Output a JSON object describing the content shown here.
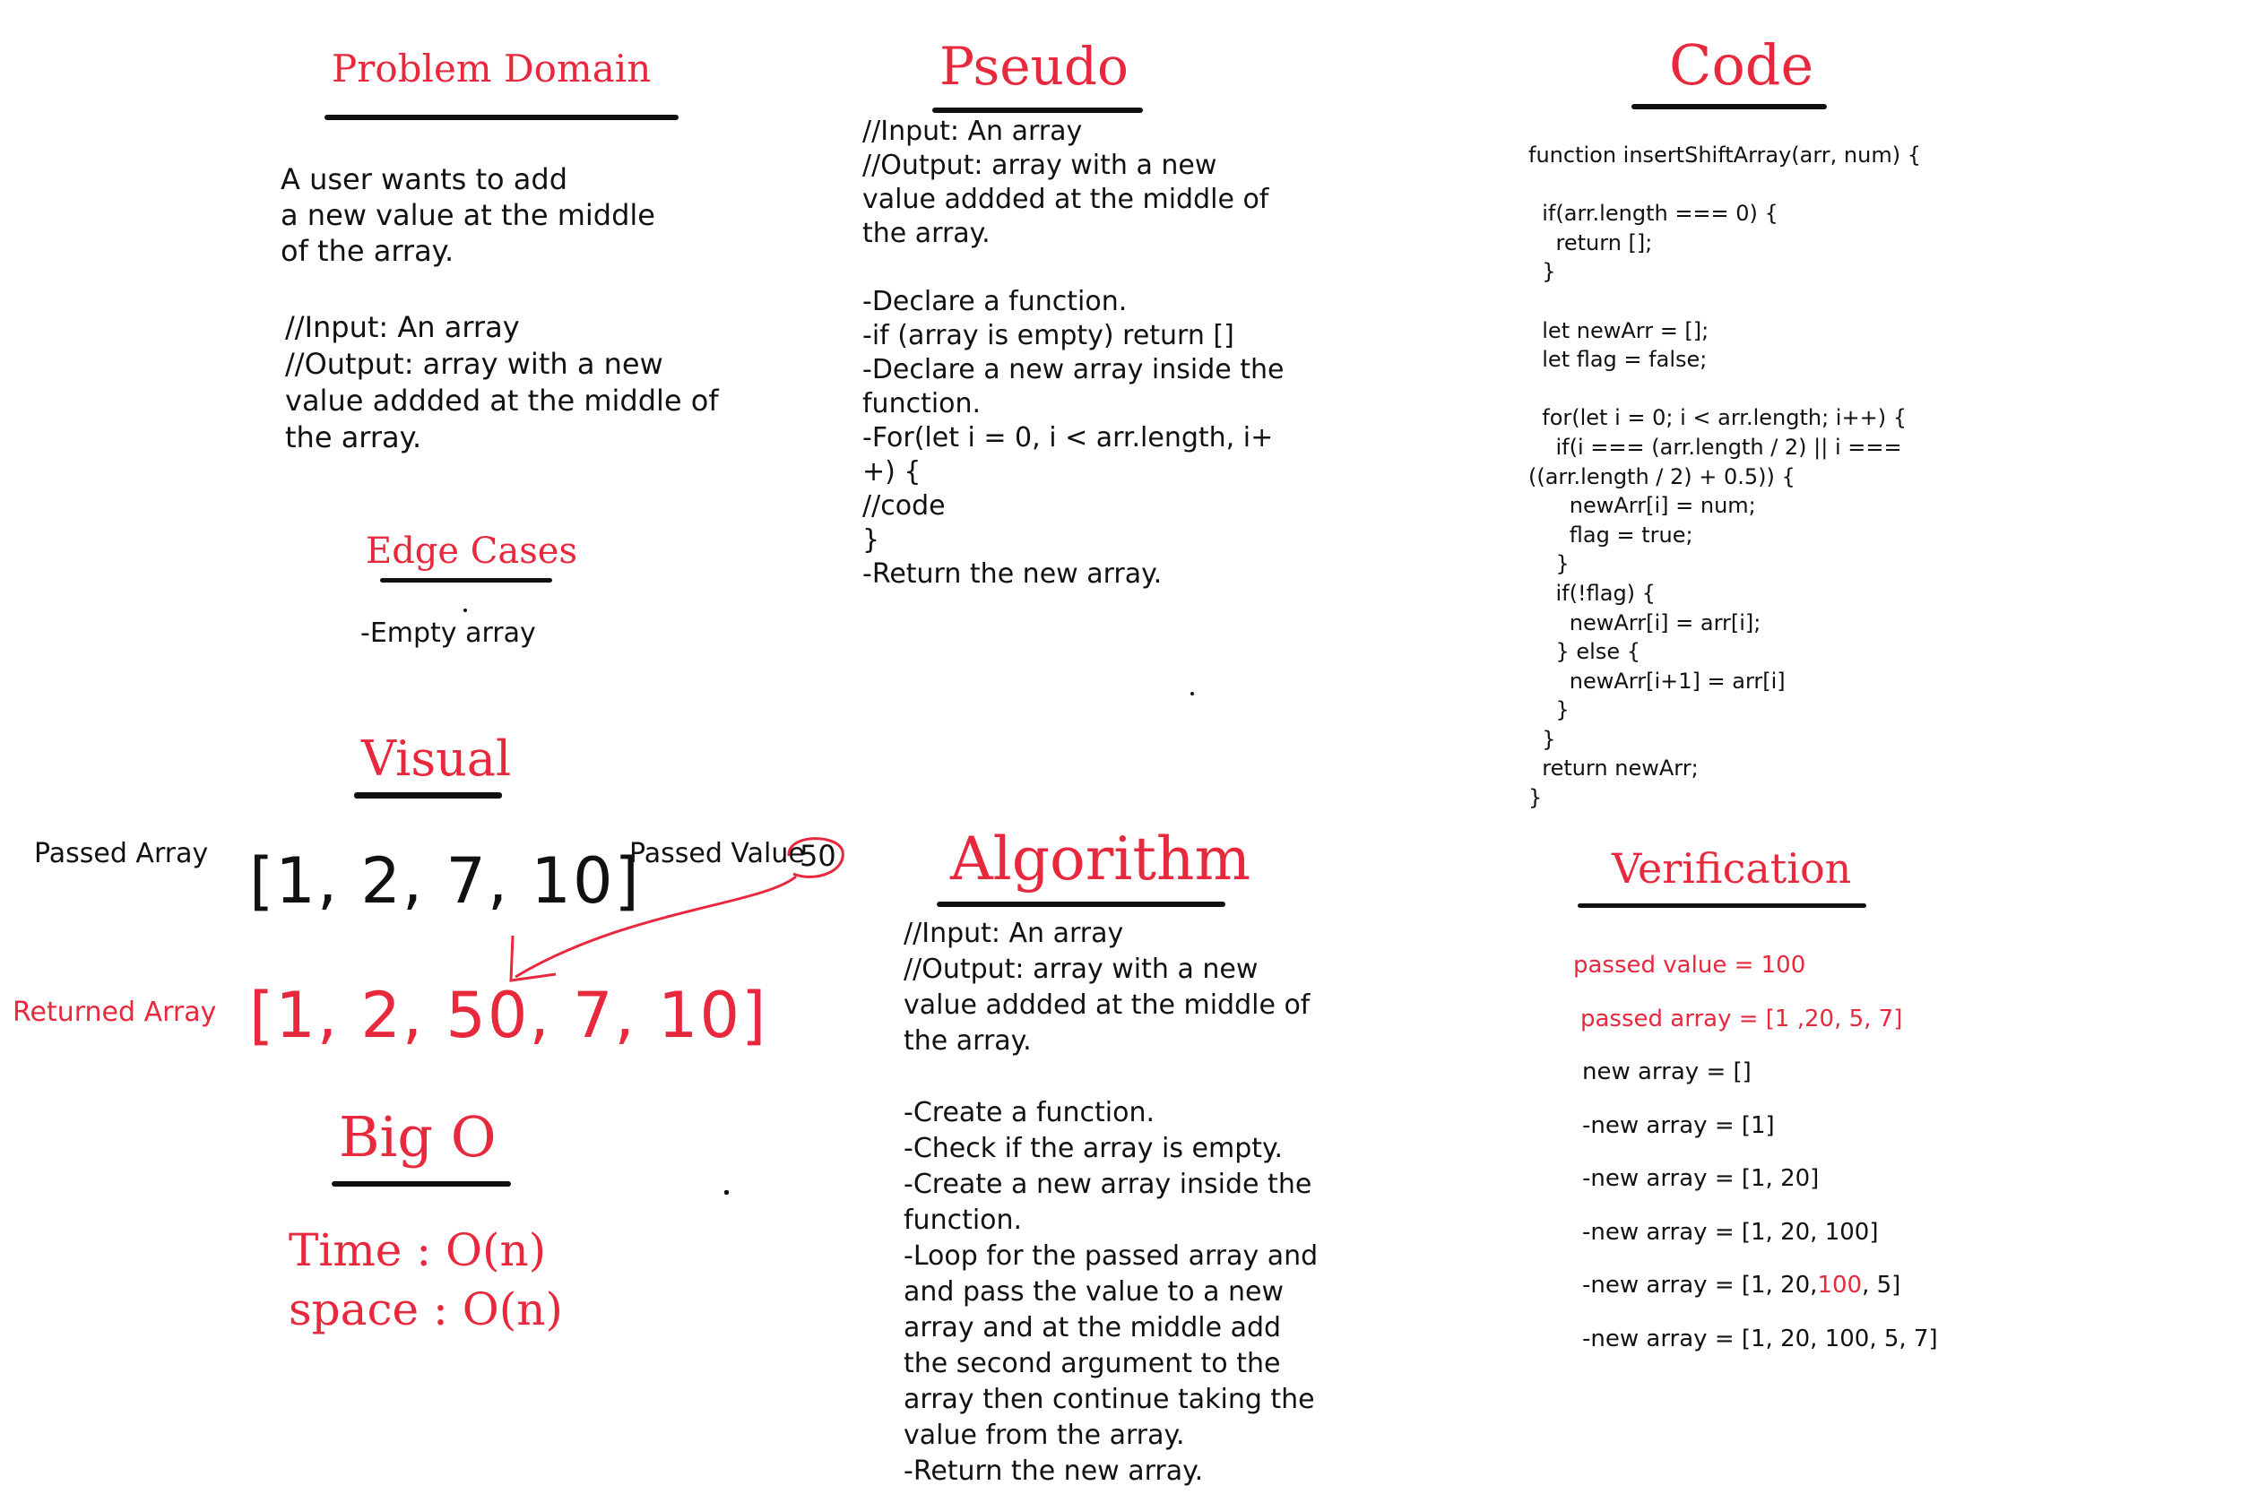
{
  "problem_domain": {
    "title": "Problem Domain",
    "description": "A user wants to add\na new value at the middle\nof the array.",
    "io": "//Input: An array\n//Output: array with a new\nvalue addded at the middle of\nthe array."
  },
  "edge_cases": {
    "title": "Edge Cases",
    "item": "-Empty array"
  },
  "pseudo": {
    "title": "Pseudo",
    "text": "//Input: An array\n//Output: array with a new\nvalue addded at the middle of\nthe array.\n\n-Declare a function.\n-if (array is empty) return []\n-Declare a new array inside the\nfunction.\n-For(let i = 0, i < arr.length, i+\n+) {\n //code\n}\n-Return the new array."
  },
  "code": {
    "title": "Code",
    "text": "function insertShiftArray(arr, num) {\n\n  if(arr.length === 0) {\n    return [];\n  }\n\n  let newArr = [];\n  let flag = false;\n\n  for(let i = 0; i < arr.length; i++) {\n    if(i === (arr.length / 2) || i ===\n((arr.length / 2) + 0.5)) {\n      newArr[i] = num;\n      flag = true;\n    }\n    if(!flag) {\n      newArr[i] = arr[i];\n    } else {\n      newArr[i+1] = arr[i]\n    }\n  }\n  return newArr;\n}"
  },
  "visual": {
    "title": "Visual",
    "passed_array_label": "Passed Array",
    "passed_array": "[1, 2, 7, 10]",
    "passed_value_label": "Passed Value",
    "passed_value": "50",
    "returned_array_label": "Returned Array",
    "returned_array": "[1, 2, 50, 7, 10]"
  },
  "big_o": {
    "title": "Big O",
    "time": "Time : O(n)",
    "space": "space : O(n)"
  },
  "algorithm": {
    "title": "Algorithm",
    "text": "//Input: An array\n//Output: array with a new\nvalue addded at the middle of\nthe array.\n\n-Create a function.\n-Check if the array is empty.\n-Create a new array inside the\nfunction.\n-Loop for the passed array and\nand pass the value to a new\narray and at the middle add\nthe second argument to the\narray then continue taking the\nvalue from the array.\n-Return the new array."
  },
  "verification": {
    "title": "Verification",
    "passed_value": "passed value = 100",
    "passed_array": "passed array = [1 ,20, 5, 7]",
    "steps": [
      "new array = []",
      "-new array = [1]",
      "-new array = [1, 20]",
      "-new array = [1, 20, 100]"
    ],
    "step5_prefix": "-new array = [1, 20,",
    "step5_red": "100",
    "step5_suffix": ", 5]",
    "step6": "-new array = [1, 20, 100, 5, 7]"
  },
  "colors": {
    "accent": "#e8283c",
    "ink": "#111111"
  }
}
